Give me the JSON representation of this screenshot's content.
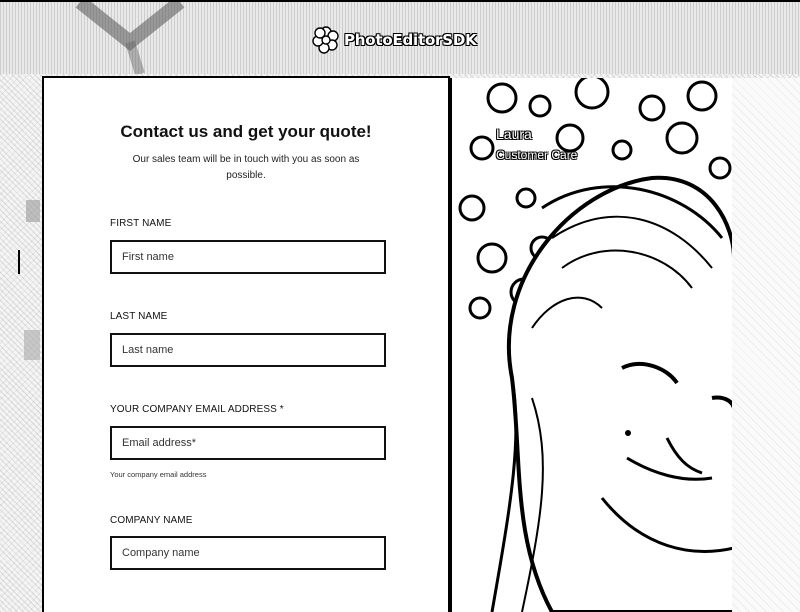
{
  "header": {
    "brand_name": "PhotoEditorSDK",
    "logo_icon": "flower-logo-icon"
  },
  "form": {
    "title": "Contact us and get your quote!",
    "subtitle": "Our sales team will be in touch with you as soon as possible.",
    "fields": [
      {
        "label": "FIRST NAME",
        "placeholder": "First name",
        "value": ""
      },
      {
        "label": "LAST NAME",
        "placeholder": "Last name",
        "value": ""
      },
      {
        "label": "YOUR COMPANY EMAIL ADDRESS *",
        "placeholder": "Email address*",
        "value": "",
        "hint": "Your company email address"
      },
      {
        "label": "COMPANY NAME",
        "placeholder": "Company name",
        "value": ""
      }
    ]
  },
  "testimonial": {
    "name": "Laura",
    "role": "Customer Care"
  },
  "colors": {
    "border": "#000000",
    "card_background": "#ffffff",
    "text": "#111111"
  }
}
